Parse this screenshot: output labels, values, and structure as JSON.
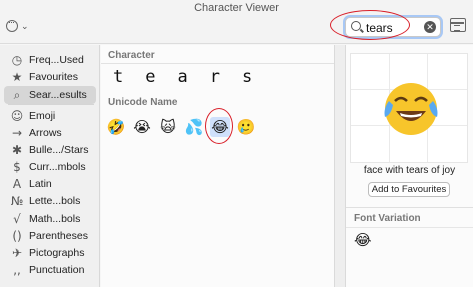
{
  "window": {
    "title": "Character Viewer"
  },
  "search": {
    "value": "tears",
    "placeholder": "Search"
  },
  "sidebar": {
    "items": [
      {
        "label": "Freq...Used",
        "icon": "clock-icon",
        "glyph": "◷"
      },
      {
        "label": "Favourites",
        "icon": "star-icon",
        "glyph": "★"
      },
      {
        "label": "Sear...esults",
        "icon": "search-icon",
        "glyph": "⌕"
      },
      {
        "label": "Emoji",
        "icon": "smiley-icon",
        "glyph": "☺"
      },
      {
        "label": "Arrows",
        "icon": "arrow-icon",
        "glyph": "→"
      },
      {
        "label": "Bulle.../Stars",
        "icon": "asterisk-icon",
        "glyph": "✱"
      },
      {
        "label": "Curr...mbols",
        "icon": "dollar-icon",
        "glyph": "$"
      },
      {
        "label": "Latin",
        "icon": "latin-letter-icon",
        "glyph": "A"
      },
      {
        "label": "Lette...bols",
        "icon": "numero-icon",
        "glyph": "№"
      },
      {
        "label": "Math...bols",
        "icon": "math-icon",
        "glyph": "√"
      },
      {
        "label": "Parentheses",
        "icon": "parentheses-icon",
        "glyph": "()"
      },
      {
        "label": "Pictographs",
        "icon": "pictograph-icon",
        "glyph": "✈"
      },
      {
        "label": "Punctuation",
        "icon": "punctuation-icon",
        "glyph": "‚,"
      }
    ]
  },
  "main": {
    "character_header": "Character",
    "characters": [
      "t",
      "e",
      "a",
      "r",
      "s"
    ],
    "unicode_header": "Unicode Name",
    "emojis": [
      {
        "name": "rolling-on-the-floor-laughing",
        "glyph": "🤣"
      },
      {
        "name": "loudly-crying-face",
        "glyph": "😭"
      },
      {
        "name": "weary-cat",
        "glyph": "🙀"
      },
      {
        "name": "sweat-droplets",
        "glyph": "💦"
      },
      {
        "name": "face-with-tears-of-joy",
        "glyph": "😂"
      },
      {
        "name": "face-holding-back-tears",
        "glyph": "🥲"
      }
    ]
  },
  "detail": {
    "char_name": "face with tears of joy",
    "fav_button": "Add to Favourites",
    "font_variation_header": "Font Variation",
    "font_variation_glyph": "😂"
  },
  "colors": {
    "highlight_ring": "#d9202a",
    "focus": "#a8c8f5",
    "emoji_face": "#f7c52b"
  }
}
